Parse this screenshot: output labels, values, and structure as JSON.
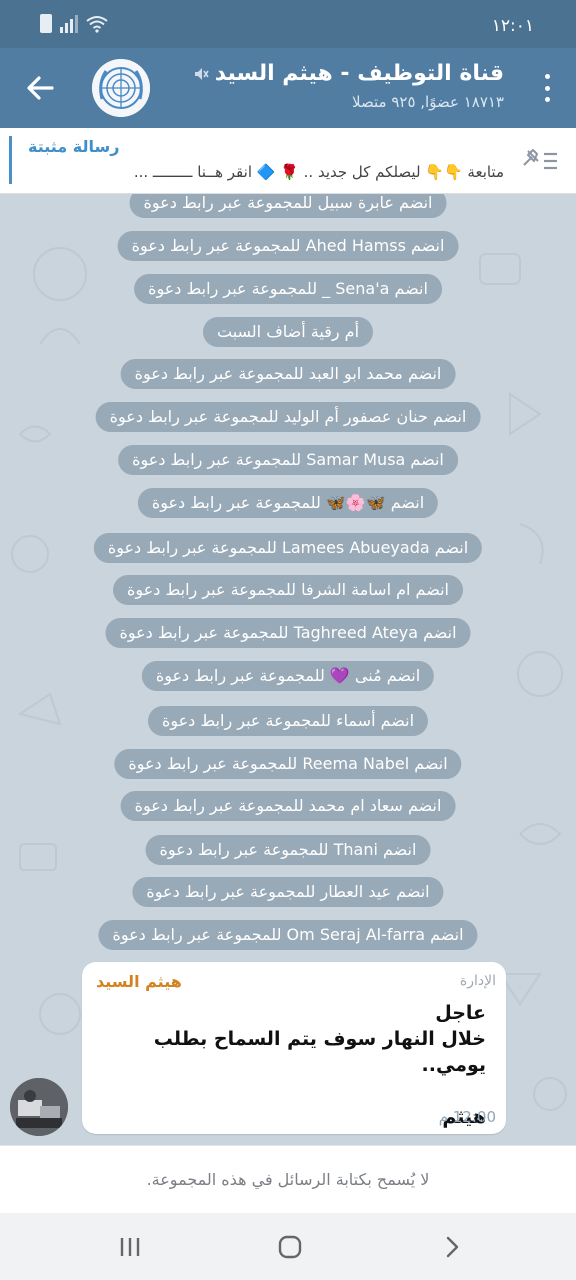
{
  "status": {
    "time": "١٢:٠١"
  },
  "header": {
    "title": "قناة التوظيف - هيثم السيد",
    "subtitle": "١٨٧١٣ عضوًا, ٩٢٥ متصلا"
  },
  "pinned": {
    "title": "رسالة مثبتة",
    "text": "متابعة 👇👇 ليصلكم كل جديد .. 🌹 🔷 انقر هــنا ـــــــــ ..."
  },
  "system_messages": [
    "انضم عابرة سبيل للمجموعة عبر رابط دعوة",
    "انضم Ahed Hamss للمجموعة عبر رابط دعوة",
    "انضم Sena'a _ للمجموعة عبر رابط دعوة",
    "أم رقية أضاف السبت",
    "انضم محمد ابو العبد للمجموعة عبر رابط دعوة",
    "انضم حنان عصفور أم الوليد للمجموعة عبر رابط دعوة",
    "انضم Samar Musa للمجموعة عبر رابط دعوة",
    "انضم 🦋🌸🦋 للمجموعة عبر رابط دعوة",
    "انضم Lamees Abueyada للمجموعة عبر رابط دعوة",
    "انضم ام اسامة الشرفا للمجموعة عبر رابط دعوة",
    "انضم Taghreed Ateya للمجموعة عبر رابط دعوة",
    "انضم مُنى 💜 للمجموعة عبر رابط دعوة",
    "انضم أسماء للمجموعة عبر رابط دعوة",
    "انضم Reema Nabel للمجموعة عبر رابط دعوة",
    "انضم سعاد ام محمد للمجموعة عبر رابط دعوة",
    "انضم Thani للمجموعة عبر رابط دعوة",
    "انضم عيد العطار للمجموعة عبر رابط دعوة",
    "انضم Om Seraj Al-farra للمجموعة عبر رابط دعوة"
  ],
  "message": {
    "sender": "هيثم السيد",
    "role": "الإدارة",
    "line1": "عاجل",
    "line2": "خلال النهار سوف يتم السماح بطلب يومي..",
    "line3": "",
    "line4": "هيثم",
    "time": "12:00 م"
  },
  "notice": "لا يُسمح بكتابة الرسائل في هذه المجموعة.",
  "colors": {
    "header": "#517da2",
    "status_bar": "#4c7292",
    "accent": "#3f8fc9",
    "sender": "#d4821f",
    "chat_bg": "#c9d4dd"
  },
  "icons": [
    "back-arrow-icon",
    "mute-icon",
    "more-vert-icon",
    "pin-list-icon",
    "recents-icon",
    "home-icon",
    "back-nav-icon"
  ]
}
